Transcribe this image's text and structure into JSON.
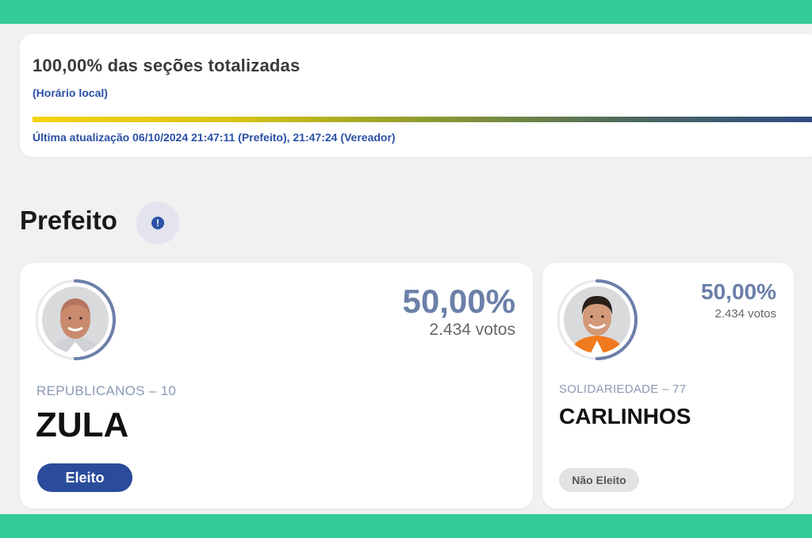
{
  "status": {
    "title": "100,00% das seções totalizadas",
    "local_time": "(Horário local)",
    "progress": 1.0,
    "last_update": "Última atualização 06/10/2024 21:47:11 (Prefeito), 21:47:24 (Vereador)"
  },
  "section": {
    "title": "Prefeito",
    "info_icon": "!"
  },
  "candidates": [
    {
      "name": "ZULA",
      "party": "REPUBLICANOS – 10",
      "percent": "50,00%",
      "votes": "2.434 votos",
      "status": "Eleito",
      "vote_share": 0.5
    },
    {
      "name": "CARLINHOS",
      "party": "SOLIDARIEDADE – 77",
      "percent": "50,00%",
      "votes": "2.434 votos",
      "status": "Não Eleito",
      "vote_share": 0.5
    }
  ],
  "colors": {
    "band": "#33cc99",
    "accent": "#2b50a6",
    "elected_badge": "#2b4b9b",
    "percent_text": "#6b7fa8"
  }
}
